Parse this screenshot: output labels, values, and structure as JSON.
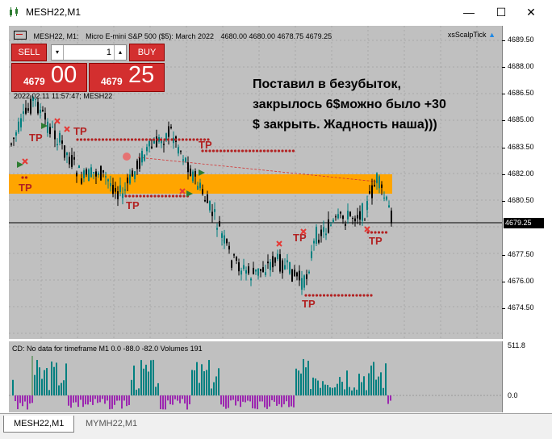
{
  "window": {
    "title": "MESH22,M1",
    "minimize_glyph": "—",
    "maximize_glyph": "☐",
    "close_glyph": "✕"
  },
  "chart": {
    "header": {
      "symbol": "MESH22, M1:",
      "description": "Micro E-mini S&P 500 ($5): March 2022",
      "ohlc": "4680.00 4680.00 4678.75 4679.25"
    },
    "ea_name": "xsScalpTick",
    "datetime": "2022.02.11 11:57:47; MESH22",
    "current_price": "4679.25",
    "price_ticks": [
      "4689.50",
      "4688.00",
      "4686.50",
      "4685.00",
      "4683.50",
      "4682.00",
      "4680.50",
      "4677.50",
      "4676.00",
      "4674.50"
    ],
    "annotation": "Поставил в безубыток,\nзакрылось 6$можно было +30\n$ закрыть. Жадность наша)))",
    "tp_label": "TP",
    "colors": {
      "bull": "#008080",
      "bear": "#000000",
      "zone": "#ffa500",
      "line": "#b22222",
      "tp": "#b22222"
    }
  },
  "trade_panel": {
    "sell_label": "SELL",
    "buy_label": "BUY",
    "lot": "1",
    "lot_down": "▾",
    "lot_up": "▴",
    "sell_price_small": "4679",
    "sell_price_big": "00",
    "buy_price_small": "4679",
    "buy_price_big": "25"
  },
  "indicator": {
    "label": "CD: No data for timeframe M1 0.0 -88.0 -82.0 Volumes 191",
    "ticks": [
      "511.8",
      "0.0"
    ]
  },
  "tabs": [
    {
      "label": "MESH22,M1",
      "active": true
    },
    {
      "label": "MYMH22,M1",
      "active": false
    }
  ]
}
